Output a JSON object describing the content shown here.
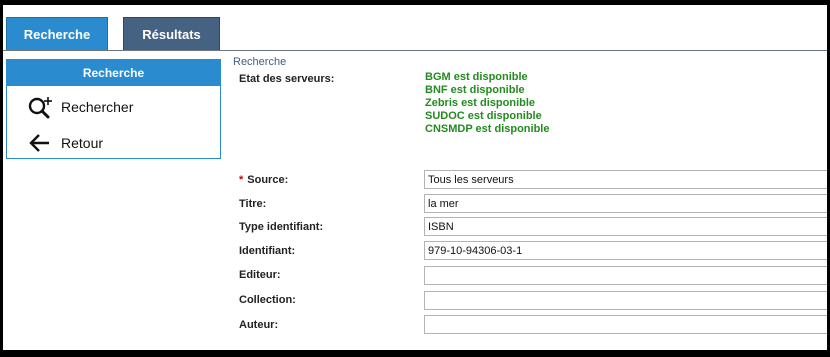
{
  "tabs": {
    "recherche": "Recherche",
    "resultats": "Résultats"
  },
  "sidebar": {
    "header": "Recherche",
    "items": [
      {
        "label": "Rechercher",
        "icon": "search-plus-icon"
      },
      {
        "label": "Retour",
        "icon": "arrow-left-icon"
      }
    ]
  },
  "main": {
    "section_title": "Recherche",
    "servers_label": "Etat des serveurs:",
    "servers": [
      "BGM est disponible",
      "BNF est disponible",
      "Zebris est disponible",
      "SUDOC est disponible",
      "CNSMDP est disponible"
    ],
    "form": {
      "required_mark": "*",
      "source": {
        "label": "Source:",
        "value": "Tous les serveurs"
      },
      "titre": {
        "label": "Titre:",
        "value": "la mer"
      },
      "type_identifiant": {
        "label": "Type identifiant:",
        "value": "ISBN"
      },
      "identifiant": {
        "label": "Identifiant:",
        "value": "979-10-94306-03-1"
      },
      "editeur": {
        "label": "Editeur:",
        "value": ""
      },
      "collection": {
        "label": "Collection:",
        "value": ""
      },
      "auteur": {
        "label": "Auteur:",
        "value": ""
      }
    }
  },
  "colors": {
    "tab_active": "#2a8bcf",
    "tab_inactive": "#456283",
    "status_ok": "#238b1f",
    "required": "#d40000"
  }
}
